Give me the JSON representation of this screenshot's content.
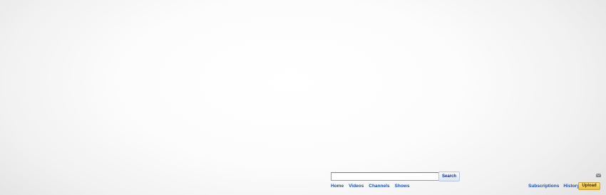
{
  "search": {
    "value": "",
    "placeholder": "",
    "button_label": "Search"
  },
  "nav": {
    "left": [
      "Home",
      "Videos",
      "Channels",
      "Shows"
    ],
    "right": [
      "Subscriptions",
      "History"
    ],
    "upload_label": "Upload"
  },
  "icons": {
    "mail": "mail-icon"
  },
  "colors": {
    "link": "#1f4fb5",
    "upload_button": "#f0c84e",
    "search_button_text": "#0d2f82"
  }
}
